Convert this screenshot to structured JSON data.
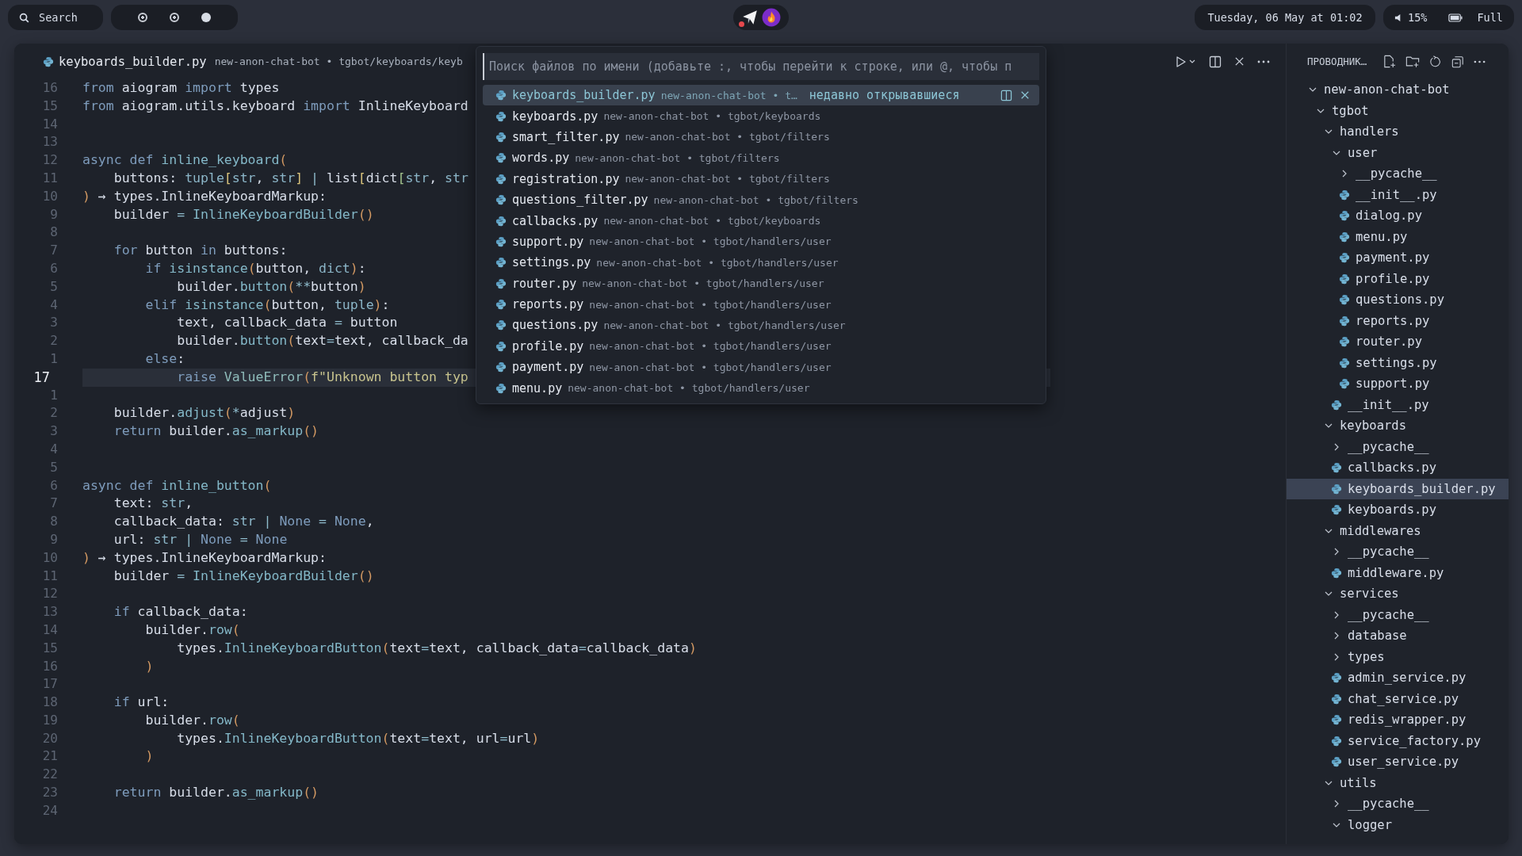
{
  "top_bar": {
    "search": {
      "label": "Search"
    },
    "workspaces": [
      {
        "selected": false
      },
      {
        "selected": false
      },
      {
        "selected": true
      }
    ],
    "tray": [
      {
        "kind": "paper-plane",
        "badge": true
      },
      {
        "kind": "flame",
        "badge": false
      }
    ],
    "clock": "Tuesday, 06 May at 01:02",
    "volume": "15%",
    "battery": "Full"
  },
  "editor": {
    "tab": {
      "file": "keyboards_builder.py",
      "path": "new-anon-chat-bot • tgbot/keyboards/keyb"
    },
    "lines": [
      {
        "number": "16",
        "current": false,
        "tokens": [
          {
            "text": "from",
            "kind": "kw"
          },
          {
            "text": " aiogram ",
            "kind": "plain"
          },
          {
            "text": "import",
            "kind": "kw"
          },
          {
            "text": " types",
            "kind": "plain"
          }
        ]
      },
      {
        "number": "15",
        "current": false,
        "tokens": [
          {
            "text": "from",
            "kind": "kw"
          },
          {
            "text": " aiogram.utils.keyboard ",
            "kind": "plain"
          },
          {
            "text": "import",
            "kind": "kw"
          },
          {
            "text": " InlineKeyboard",
            "kind": "plain"
          }
        ]
      },
      {
        "number": "14",
        "current": false
      },
      {
        "number": "13",
        "current": false
      },
      {
        "number": "12",
        "current": false,
        "tokens": [
          {
            "text": "async def ",
            "kind": "kw"
          },
          {
            "text": "inline_keyboard",
            "kind": "fn"
          },
          {
            "text": "(",
            "kind": "punc"
          }
        ]
      },
      {
        "number": "11",
        "current": false,
        "tokens": [
          {
            "text": "    buttons: ",
            "kind": "plain"
          },
          {
            "text": "tuple",
            "kind": "type"
          },
          {
            "text": "[",
            "kind": "bracket"
          },
          {
            "text": "str",
            "kind": "type"
          },
          {
            "text": ", ",
            "kind": "plain"
          },
          {
            "text": "str",
            "kind": "type"
          },
          {
            "text": "]",
            "kind": "bracket"
          },
          {
            "text": " | ",
            "kind": "op"
          },
          {
            "text": "list",
            "kind": "plain"
          },
          {
            "text": "[",
            "kind": "bracket"
          },
          {
            "text": "dict",
            "kind": "plain"
          },
          {
            "text": "[",
            "kind": "bracket2"
          },
          {
            "text": "str",
            "kind": "type"
          },
          {
            "text": ", ",
            "kind": "plain"
          },
          {
            "text": "str",
            "kind": "type"
          }
        ]
      },
      {
        "number": "10",
        "current": false,
        "tokens": [
          {
            "text": ")",
            "kind": "punc"
          },
          {
            "text": " → types.InlineKeyboardMarkup:",
            "kind": "plain"
          }
        ]
      },
      {
        "number": "9",
        "current": false,
        "tokens": [
          {
            "text": "    builder ",
            "kind": "plain"
          },
          {
            "text": "= ",
            "kind": "op"
          },
          {
            "text": "InlineKeyboardBuilder",
            "kind": "fn"
          },
          {
            "text": "()",
            "kind": "punc"
          }
        ]
      },
      {
        "number": "8",
        "current": false
      },
      {
        "number": "7",
        "current": false,
        "tokens": [
          {
            "text": "    for",
            "kind": "kw"
          },
          {
            "text": " button ",
            "kind": "plain"
          },
          {
            "text": "in",
            "kind": "kw"
          },
          {
            "text": " buttons:",
            "kind": "plain"
          }
        ]
      },
      {
        "number": "6",
        "current": false,
        "tokens": [
          {
            "text": "        if ",
            "kind": "kw"
          },
          {
            "text": "isinstance",
            "kind": "fn"
          },
          {
            "text": "(",
            "kind": "punc"
          },
          {
            "text": "button, ",
            "kind": "plain"
          },
          {
            "text": "dict",
            "kind": "type"
          },
          {
            "text": ")",
            "kind": "punc"
          },
          {
            "text": ":",
            "kind": "plain"
          }
        ]
      },
      {
        "number": "5",
        "current": false,
        "tokens": [
          {
            "text": "            builder.",
            "kind": "plain"
          },
          {
            "text": "button",
            "kind": "fn"
          },
          {
            "text": "(",
            "kind": "punc"
          },
          {
            "text": "**",
            "kind": "op"
          },
          {
            "text": "button",
            "kind": "plain"
          },
          {
            "text": ")",
            "kind": "punc"
          }
        ]
      },
      {
        "number": "4",
        "current": false,
        "tokens": [
          {
            "text": "        elif ",
            "kind": "kw"
          },
          {
            "text": "isinstance",
            "kind": "fn"
          },
          {
            "text": "(",
            "kind": "punc"
          },
          {
            "text": "button, ",
            "kind": "plain"
          },
          {
            "text": "tuple",
            "kind": "type"
          },
          {
            "text": ")",
            "kind": "punc"
          },
          {
            "text": ":",
            "kind": "plain"
          }
        ]
      },
      {
        "number": "3",
        "current": false,
        "tokens": [
          {
            "text": "            text, callback_data ",
            "kind": "plain"
          },
          {
            "text": "=",
            "kind": "op"
          },
          {
            "text": " button",
            "kind": "plain"
          }
        ]
      },
      {
        "number": "2",
        "current": false,
        "tokens": [
          {
            "text": "            builder.",
            "kind": "plain"
          },
          {
            "text": "button",
            "kind": "fn"
          },
          {
            "text": "(",
            "kind": "punc"
          },
          {
            "text": "text",
            "kind": "plain"
          },
          {
            "text": "=",
            "kind": "op"
          },
          {
            "text": "text, callback_da",
            "kind": "plain"
          }
        ]
      },
      {
        "number": "1",
        "current": false,
        "tokens": [
          {
            "text": "        else",
            "kind": "kw"
          },
          {
            "text": ":",
            "kind": "plain"
          }
        ]
      },
      {
        "number": "17",
        "current": true,
        "tokens": [
          {
            "text": "            raise ",
            "kind": "kw"
          },
          {
            "text": "ValueError",
            "kind": "cls"
          },
          {
            "text": "(",
            "kind": "punc"
          },
          {
            "text": "f\"Unknown button typ",
            "kind": "str"
          }
        ]
      },
      {
        "number": "1",
        "current": false
      },
      {
        "number": "2",
        "current": false,
        "tokens": [
          {
            "text": "    builder.",
            "kind": "plain"
          },
          {
            "text": "adjust",
            "kind": "fn"
          },
          {
            "text": "(",
            "kind": "punc"
          },
          {
            "text": "*",
            "kind": "op"
          },
          {
            "text": "adjust",
            "kind": "plain"
          },
          {
            "text": ")",
            "kind": "punc"
          }
        ]
      },
      {
        "number": "3",
        "current": false,
        "tokens": [
          {
            "text": "    return",
            "kind": "kw"
          },
          {
            "text": " builder.",
            "kind": "plain"
          },
          {
            "text": "as_markup",
            "kind": "fn"
          },
          {
            "text": "()",
            "kind": "punc"
          }
        ]
      },
      {
        "number": "4",
        "current": false
      },
      {
        "number": "5",
        "current": false
      },
      {
        "number": "6",
        "current": false,
        "tokens": [
          {
            "text": "async def ",
            "kind": "kw"
          },
          {
            "text": "inline_button",
            "kind": "fn"
          },
          {
            "text": "(",
            "kind": "punc"
          }
        ]
      },
      {
        "number": "7",
        "current": false,
        "tokens": [
          {
            "text": "    text: ",
            "kind": "plain"
          },
          {
            "text": "str",
            "kind": "type"
          },
          {
            "text": ",",
            "kind": "plain"
          }
        ]
      },
      {
        "number": "8",
        "current": false,
        "tokens": [
          {
            "text": "    callback_data: ",
            "kind": "plain"
          },
          {
            "text": "str",
            "kind": "type"
          },
          {
            "text": " | ",
            "kind": "op"
          },
          {
            "text": "None",
            "kind": "kw"
          },
          {
            "text": " = ",
            "kind": "op"
          },
          {
            "text": "None",
            "kind": "kw"
          },
          {
            "text": ",",
            "kind": "plain"
          }
        ]
      },
      {
        "number": "9",
        "current": false,
        "tokens": [
          {
            "text": "    url: ",
            "kind": "plain"
          },
          {
            "text": "str",
            "kind": "type"
          },
          {
            "text": " | ",
            "kind": "op"
          },
          {
            "text": "None",
            "kind": "kw"
          },
          {
            "text": " = ",
            "kind": "op"
          },
          {
            "text": "None",
            "kind": "kw"
          }
        ]
      },
      {
        "number": "10",
        "current": false,
        "tokens": [
          {
            "text": ")",
            "kind": "punc"
          },
          {
            "text": " → types.InlineKeyboardMarkup:",
            "kind": "plain"
          }
        ]
      },
      {
        "number": "11",
        "current": false,
        "tokens": [
          {
            "text": "    builder ",
            "kind": "plain"
          },
          {
            "text": "= ",
            "kind": "op"
          },
          {
            "text": "InlineKeyboardBuilder",
            "kind": "fn"
          },
          {
            "text": "()",
            "kind": "punc"
          }
        ]
      },
      {
        "number": "12",
        "current": false
      },
      {
        "number": "13",
        "current": false,
        "tokens": [
          {
            "text": "    if",
            "kind": "kw"
          },
          {
            "text": " callback_data:",
            "kind": "plain"
          }
        ]
      },
      {
        "number": "14",
        "current": false,
        "tokens": [
          {
            "text": "        builder.",
            "kind": "plain"
          },
          {
            "text": "row",
            "kind": "fn"
          },
          {
            "text": "(",
            "kind": "punc"
          }
        ]
      },
      {
        "number": "15",
        "current": false,
        "tokens": [
          {
            "text": "            types.",
            "kind": "plain"
          },
          {
            "text": "InlineKeyboardButton",
            "kind": "fn"
          },
          {
            "text": "(",
            "kind": "punc"
          },
          {
            "text": "text",
            "kind": "plain"
          },
          {
            "text": "=",
            "kind": "op"
          },
          {
            "text": "text, callback_data",
            "kind": "plain"
          },
          {
            "text": "=",
            "kind": "op"
          },
          {
            "text": "callback_data",
            "kind": "plain"
          },
          {
            "text": ")",
            "kind": "punc"
          }
        ]
      },
      {
        "number": "16",
        "current": false,
        "tokens": [
          {
            "text": "        )",
            "kind": "punc"
          }
        ]
      },
      {
        "number": "17",
        "current": false
      },
      {
        "number": "18",
        "current": false,
        "tokens": [
          {
            "text": "    if",
            "kind": "kw"
          },
          {
            "text": " url:",
            "kind": "plain"
          }
        ]
      },
      {
        "number": "19",
        "current": false,
        "tokens": [
          {
            "text": "        builder.",
            "kind": "plain"
          },
          {
            "text": "row",
            "kind": "fn"
          },
          {
            "text": "(",
            "kind": "punc"
          }
        ]
      },
      {
        "number": "20",
        "current": false,
        "tokens": [
          {
            "text": "            types.",
            "kind": "plain"
          },
          {
            "text": "InlineKeyboardButton",
            "kind": "fn"
          },
          {
            "text": "(",
            "kind": "punc"
          },
          {
            "text": "text",
            "kind": "plain"
          },
          {
            "text": "=",
            "kind": "op"
          },
          {
            "text": "text, url",
            "kind": "plain"
          },
          {
            "text": "=",
            "kind": "op"
          },
          {
            "text": "url",
            "kind": "plain"
          },
          {
            "text": ")",
            "kind": "punc"
          }
        ]
      },
      {
        "number": "21",
        "current": false,
        "tokens": [
          {
            "text": "        )",
            "kind": "punc"
          }
        ]
      },
      {
        "number": "22",
        "current": false
      },
      {
        "number": "23",
        "current": false,
        "tokens": [
          {
            "text": "    return",
            "kind": "kw"
          },
          {
            "text": " builder.",
            "kind": "plain"
          },
          {
            "text": "as_markup",
            "kind": "fn"
          },
          {
            "text": "()",
            "kind": "punc"
          }
        ]
      },
      {
        "number": "24",
        "current": false
      }
    ]
  },
  "quick_open": {
    "placeholder": "Поиск файлов по имени (добавьте :, чтобы перейти к строке, или @, чтобы п",
    "results": [
      {
        "name": "keyboards_builder.py",
        "detail": "new-anon-chat-bot • t…",
        "note": "недавно открывавшиеся",
        "selected": true
      },
      {
        "name": "keyboards.py",
        "detail": "new-anon-chat-bot • tgbot/keyboards",
        "selected": false
      },
      {
        "name": "smart_filter.py",
        "detail": "new-anon-chat-bot • tgbot/filters",
        "selected": false
      },
      {
        "name": "words.py",
        "detail": "new-anon-chat-bot • tgbot/filters",
        "selected": false
      },
      {
        "name": "registration.py",
        "detail": "new-anon-chat-bot • tgbot/filters",
        "selected": false
      },
      {
        "name": "questions_filter.py",
        "detail": "new-anon-chat-bot • tgbot/filters",
        "selected": false
      },
      {
        "name": "callbacks.py",
        "detail": "new-anon-chat-bot • tgbot/keyboards",
        "selected": false
      },
      {
        "name": "support.py",
        "detail": "new-anon-chat-bot • tgbot/handlers/user",
        "selected": false
      },
      {
        "name": "settings.py",
        "detail": "new-anon-chat-bot • tgbot/handlers/user",
        "selected": false
      },
      {
        "name": "router.py",
        "detail": "new-anon-chat-bot • tgbot/handlers/user",
        "selected": false
      },
      {
        "name": "reports.py",
        "detail": "new-anon-chat-bot • tgbot/handlers/user",
        "selected": false
      },
      {
        "name": "questions.py",
        "detail": "new-anon-chat-bot • tgbot/handlers/user",
        "selected": false
      },
      {
        "name": "profile.py",
        "detail": "new-anon-chat-bot • tgbot/handlers/user",
        "selected": false
      },
      {
        "name": "payment.py",
        "detail": "new-anon-chat-bot • tgbot/handlers/user",
        "selected": false
      },
      {
        "name": "menu.py",
        "detail": "new-anon-chat-bot • tgbot/handlers/user",
        "selected": false
      }
    ]
  },
  "sidebar": {
    "title": "ПРОВОДНИК…",
    "tree": [
      {
        "name": "new-anon-chat-bot",
        "kind": "folder",
        "expanded": true,
        "selected": false,
        "children": [
          {
            "name": "tgbot",
            "kind": "folder",
            "expanded": true,
            "selected": false,
            "children": [
              {
                "name": "handlers",
                "kind": "folder",
                "expanded": true,
                "selected": false,
                "children": [
                  {
                    "name": "user",
                    "kind": "folder",
                    "expanded": true,
                    "selected": false,
                    "children": [
                      {
                        "name": "__pycache__",
                        "kind": "folder",
                        "expanded": false,
                        "selected": false
                      },
                      {
                        "name": "__init__.py",
                        "kind": "file",
                        "selected": false
                      },
                      {
                        "name": "dialog.py",
                        "kind": "file",
                        "selected": false
                      },
                      {
                        "name": "menu.py",
                        "kind": "file",
                        "selected": false
                      },
                      {
                        "name": "payment.py",
                        "kind": "file",
                        "selected": false
                      },
                      {
                        "name": "profile.py",
                        "kind": "file",
                        "selected": false
                      },
                      {
                        "name": "questions.py",
                        "kind": "file",
                        "selected": false
                      },
                      {
                        "name": "reports.py",
                        "kind": "file",
                        "selected": false
                      },
                      {
                        "name": "router.py",
                        "kind": "file",
                        "selected": false
                      },
                      {
                        "name": "settings.py",
                        "kind": "file",
                        "selected": false
                      },
                      {
                        "name": "support.py",
                        "kind": "file",
                        "selected": false
                      }
                    ]
                  },
                  {
                    "name": "__init__.py",
                    "kind": "file",
                    "selected": false
                  }
                ]
              },
              {
                "name": "keyboards",
                "kind": "folder",
                "expanded": true,
                "selected": false,
                "children": [
                  {
                    "name": "__pycache__",
                    "kind": "folder",
                    "expanded": false,
                    "selected": false
                  },
                  {
                    "name": "callbacks.py",
                    "kind": "file",
                    "selected": false
                  },
                  {
                    "name": "keyboards_builder.py",
                    "kind": "file",
                    "selected": true
                  },
                  {
                    "name": "keyboards.py",
                    "kind": "file",
                    "selected": false
                  }
                ]
              },
              {
                "name": "middlewares",
                "kind": "folder",
                "expanded": true,
                "selected": false,
                "children": [
                  {
                    "name": "__pycache__",
                    "kind": "folder",
                    "expanded": false,
                    "selected": false
                  },
                  {
                    "name": "middleware.py",
                    "kind": "file",
                    "selected": false
                  }
                ]
              },
              {
                "name": "services",
                "kind": "folder",
                "expanded": true,
                "selected": false,
                "children": [
                  {
                    "name": "__pycache__",
                    "kind": "folder",
                    "expanded": false,
                    "selected": false
                  },
                  {
                    "name": "database",
                    "kind": "folder",
                    "expanded": false,
                    "selected": false
                  },
                  {
                    "name": "types",
                    "kind": "folder",
                    "expanded": false,
                    "selected": false
                  },
                  {
                    "name": "admin_service.py",
                    "kind": "file",
                    "selected": false
                  },
                  {
                    "name": "chat_service.py",
                    "kind": "file",
                    "selected": false
                  },
                  {
                    "name": "redis_wrapper.py",
                    "kind": "file",
                    "selected": false
                  },
                  {
                    "name": "service_factory.py",
                    "kind": "file",
                    "selected": false
                  },
                  {
                    "name": "user_service.py",
                    "kind": "file",
                    "selected": false
                  }
                ]
              },
              {
                "name": "utils",
                "kind": "folder",
                "expanded": true,
                "selected": false,
                "children": [
                  {
                    "name": "__pycache__",
                    "kind": "folder",
                    "expanded": false,
                    "selected": false
                  },
                  {
                    "name": "logger",
                    "kind": "folder",
                    "expanded": true,
                    "selected": false
                  }
                ]
              }
            ]
          }
        ]
      }
    ]
  }
}
